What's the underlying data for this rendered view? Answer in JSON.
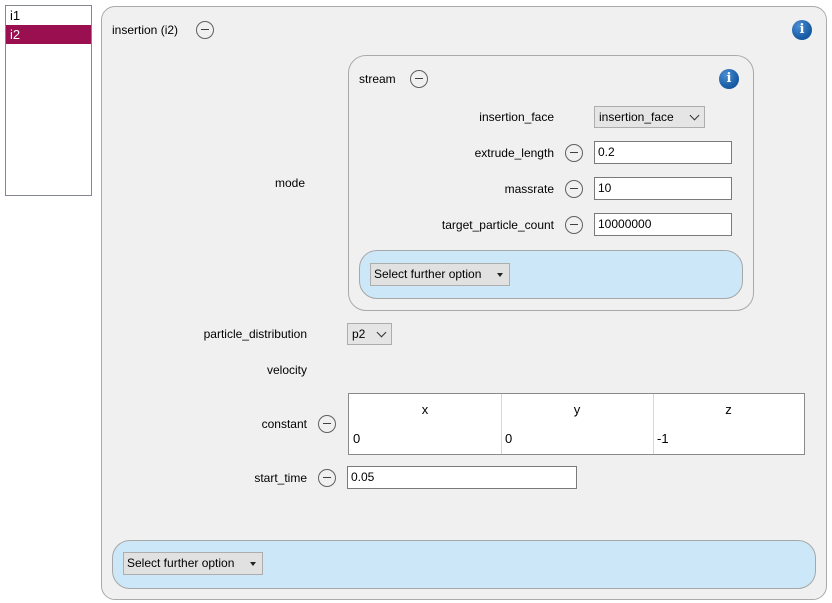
{
  "list": {
    "items": [
      {
        "label": "i1",
        "selected": false
      },
      {
        "label": "i2",
        "selected": true
      }
    ]
  },
  "insertion": {
    "title": "insertion (i2)",
    "mode_label": "mode",
    "stream": {
      "title": "stream",
      "fields": {
        "insertion_face": {
          "label": "insertion_face",
          "value": "insertion_face"
        },
        "extrude_length": {
          "label": "extrude_length",
          "value": "0.2"
        },
        "massrate": {
          "label": "massrate",
          "value": "10"
        },
        "target_particle_count": {
          "label": "target_particle_count",
          "value": "10000000"
        }
      },
      "further_option_label": "Select further option"
    },
    "particle_distribution": {
      "label": "particle_distribution",
      "value": "p2"
    },
    "velocity_label": "velocity",
    "constant": {
      "label": "constant",
      "columns": [
        "x",
        "y",
        "z"
      ],
      "values": [
        "0",
        "0",
        "-1"
      ]
    },
    "start_time": {
      "label": "start_time",
      "value": "0.05"
    },
    "further_option_label": "Select further option"
  },
  "icons": {
    "info": "info-icon",
    "remove": "circle-minus-icon",
    "dropdown": "chevron-down-icon"
  },
  "colors": {
    "selection": "#990f4f",
    "option_panel": "#cce8f8",
    "info_blue": "#1a5fa8"
  }
}
